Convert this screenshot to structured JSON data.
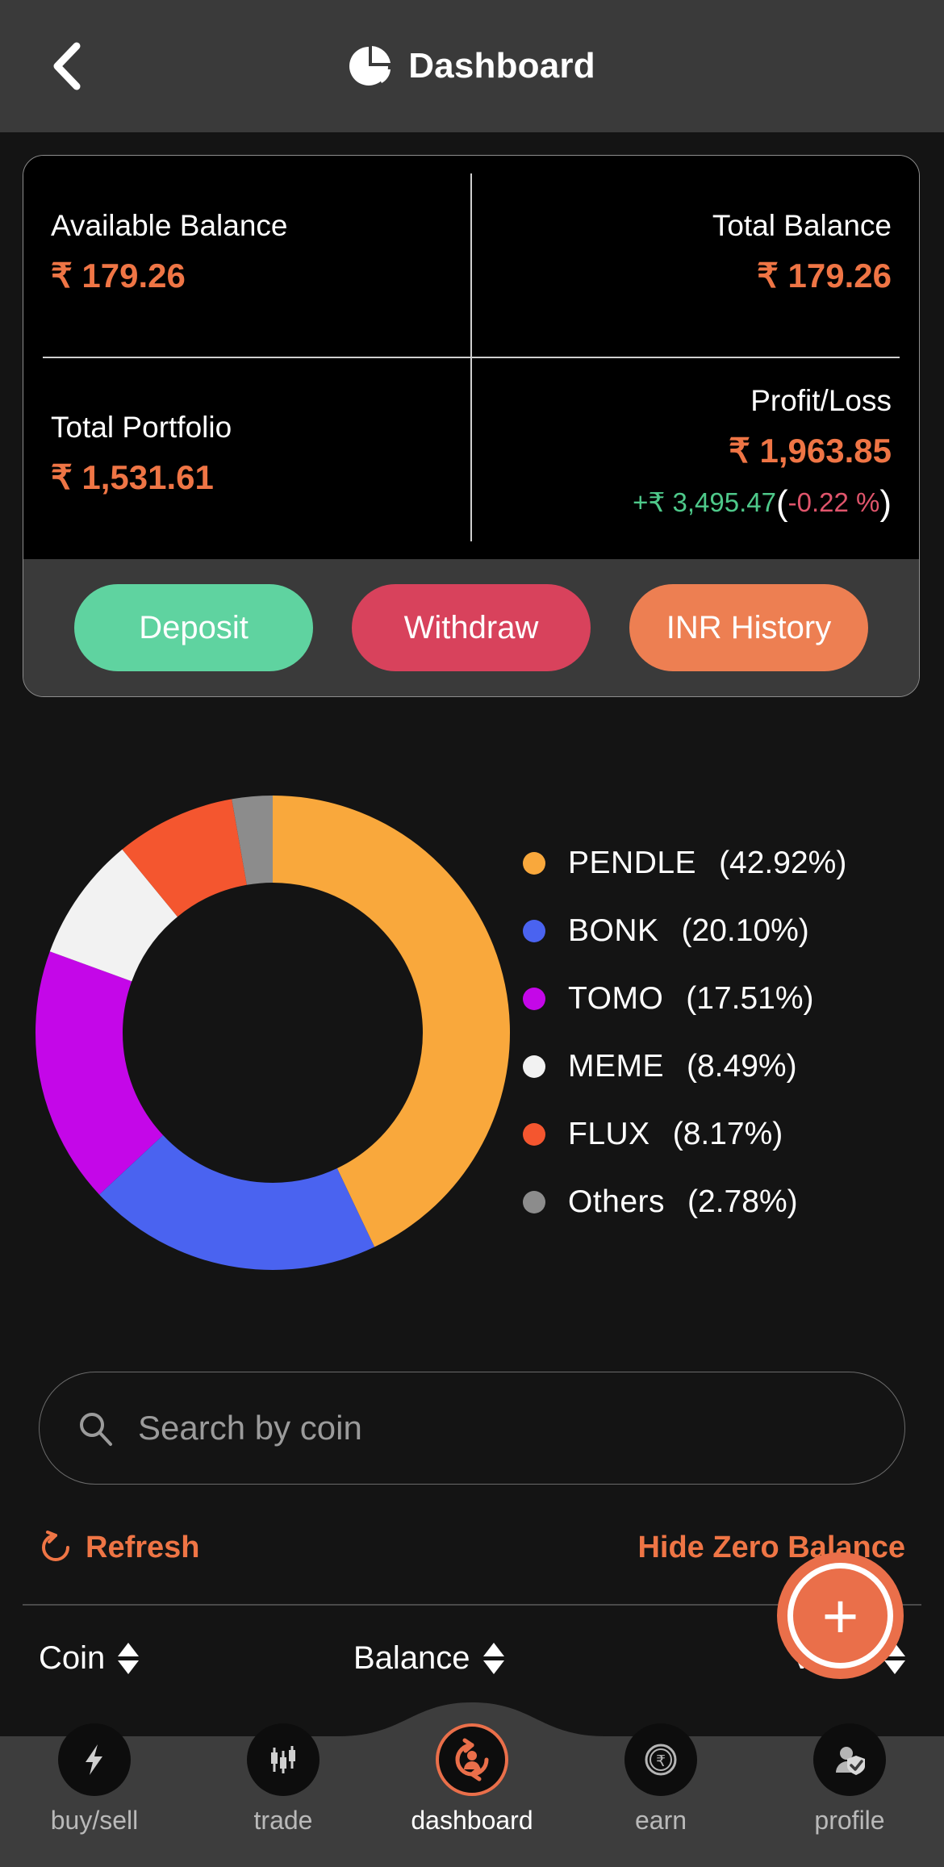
{
  "header": {
    "back_icon": "chevron-left-icon",
    "logo_icon": "pie-chart-icon",
    "title": "Dashboard"
  },
  "balance_card": {
    "cells": [
      {
        "label": "Available Balance",
        "value": "₹ 179.26",
        "align": "left"
      },
      {
        "label": "Total Balance",
        "value": "₹ 179.26",
        "align": "right"
      },
      {
        "label": "Total Portfolio",
        "value": "₹ 1,531.61",
        "align": "left"
      },
      {
        "label": "Profit/Loss",
        "value": "₹ 1,963.85",
        "align": "right"
      }
    ],
    "profit_change_amount": "+₹ 3,495.47",
    "profit_change_pct": "-0.22 %",
    "paren_open": "(",
    "paren_close": ")",
    "buttons": [
      {
        "label": "Deposit",
        "color": "#5fd3a0"
      },
      {
        "label": "Withdraw",
        "color": "#d8425c"
      },
      {
        "label": "INR History",
        "color": "#ed7f52"
      }
    ]
  },
  "chart_data": {
    "type": "pie",
    "title": "",
    "legend_position": "right",
    "categories": [
      "PENDLE",
      "BONK",
      "TOMO",
      "MEME",
      "FLUX",
      "Others"
    ],
    "values": [
      42.92,
      20.1,
      17.51,
      8.49,
      8.17,
      2.78
    ],
    "colors": [
      "#f9a83c",
      "#4a63f0",
      "#c407e8",
      "#f2f2f2",
      "#f4562f",
      "#8c8c8c"
    ],
    "legend": [
      {
        "name": "PENDLE",
        "pct": "(42.92%)",
        "color": "#f9a83c"
      },
      {
        "name": "BONK",
        "pct": "(20.10%)",
        "color": "#4a63f0"
      },
      {
        "name": "TOMO",
        "pct": "(17.51%)",
        "color": "#c407e8"
      },
      {
        "name": "MEME",
        "pct": "(8.49%)",
        "color": "#f2f2f2"
      },
      {
        "name": "FLUX",
        "pct": "(8.17%)",
        "color": "#f4562f"
      },
      {
        "name": "Others",
        "pct": "(2.78%)",
        "color": "#8c8c8c"
      }
    ]
  },
  "search": {
    "icon": "search-icon",
    "placeholder": "Search by coin",
    "value": ""
  },
  "controls": {
    "refresh_icon": "refresh-icon",
    "refresh_label": "Refresh",
    "hide_zero_label": "Hide Zero Balance"
  },
  "table": {
    "columns": [
      {
        "label": "Coin",
        "sort_icon": "sort-updown-icon"
      },
      {
        "label": "Balance",
        "sort_icon": "sort-updown-icon"
      },
      {
        "label": "Value",
        "sort_icon": "sort-updown-icon"
      }
    ]
  },
  "fab": {
    "icon": "plus-icon",
    "label": "+",
    "color": "#ea6f4a"
  },
  "bottom_nav": {
    "active": "dashboard",
    "items": [
      {
        "label": "buy/sell",
        "icon": "lightning-bolt-icon"
      },
      {
        "label": "trade",
        "icon": "candlestick-chart-icon"
      },
      {
        "label": "dashboard",
        "icon": "portfolio-refresh-icon"
      },
      {
        "label": "earn",
        "icon": "rupee-coin-icon"
      },
      {
        "label": "profile",
        "icon": "user-shield-icon"
      }
    ]
  },
  "theme": {
    "accent": "#ef7545",
    "bg": "#141414",
    "header_bg": "#3a3a3a",
    "positive": "#4ec98a",
    "negative": "#e0556c"
  }
}
